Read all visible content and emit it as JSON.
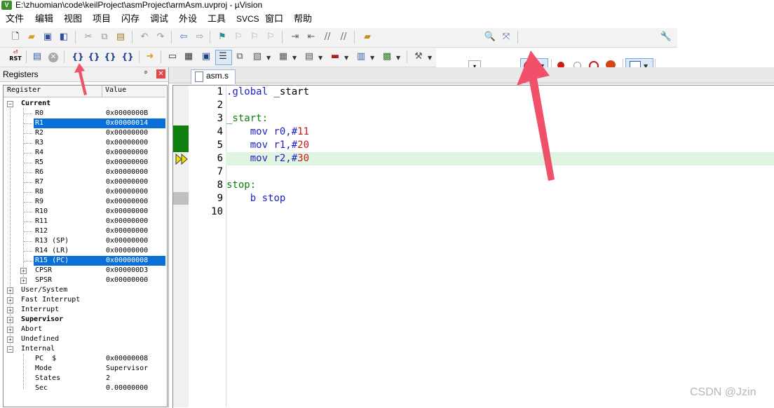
{
  "window": {
    "title": "E:\\zhuomian\\code\\keilProject\\asmProject\\armAsm.uvproj - µVision",
    "icon": "uvision-app-icon"
  },
  "menu": [
    "文件",
    "编辑",
    "视图",
    "项目",
    "闪存",
    "调试",
    "外设",
    "工具",
    "SVCS",
    "窗口",
    "帮助"
  ],
  "registers_panel": {
    "title": "Registers",
    "pin_icon": "pin-icon",
    "close_icon": "close-icon",
    "columns": {
      "register": "Register",
      "value": "Value"
    },
    "current_group": "Current",
    "rows": [
      {
        "name": "R0",
        "value": "0x0000000B"
      },
      {
        "name": "R1",
        "value": "0x00000014",
        "selected": true
      },
      {
        "name": "R2",
        "value": "0x00000000"
      },
      {
        "name": "R3",
        "value": "0x00000000"
      },
      {
        "name": "R4",
        "value": "0x00000000"
      },
      {
        "name": "R5",
        "value": "0x00000000"
      },
      {
        "name": "R6",
        "value": "0x00000000"
      },
      {
        "name": "R7",
        "value": "0x00000000"
      },
      {
        "name": "R8",
        "value": "0x00000000"
      },
      {
        "name": "R9",
        "value": "0x00000000"
      },
      {
        "name": "R10",
        "value": "0x00000000"
      },
      {
        "name": "R11",
        "value": "0x00000000"
      },
      {
        "name": "R12",
        "value": "0x00000000"
      },
      {
        "name": "R13 (SP)",
        "value": "0x00000000"
      },
      {
        "name": "R14 (LR)",
        "value": "0x00000000"
      },
      {
        "name": "R15 (PC)",
        "value": "0x00000008",
        "selected": true
      },
      {
        "name": "CPSR",
        "value": "0x000000D3",
        "expandable": true
      },
      {
        "name": "SPSR",
        "value": "0x00000000",
        "expandable": true
      }
    ],
    "groups": [
      "User/System",
      "Fast Interrupt",
      "Interrupt",
      "Supervisor",
      "Abort",
      "Undefined"
    ],
    "internal": {
      "label": "Internal",
      "rows": [
        {
          "name": "PC  $",
          "value": "0x00000008"
        },
        {
          "name": "Mode",
          "value": "Supervisor"
        },
        {
          "name": "States",
          "value": "2"
        },
        {
          "name": "Sec",
          "value": "0.00000000"
        }
      ]
    }
  },
  "editor": {
    "tab_label": "asm.s",
    "line_numbers": [
      "1",
      "2",
      "3",
      "4",
      "5",
      "6",
      "7",
      "8",
      "9",
      "10"
    ],
    "code": {
      "l1_a": ".global",
      "l1_b": " _start",
      "l3": "_start:",
      "l4_a": "    mov",
      "l4_b": " r0,#",
      "l4_c": "11",
      "l5_a": "    mov",
      "l5_b": " r1,#",
      "l5_c": "20",
      "l6_a": "    mov",
      "l6_b": " r2,#",
      "l6_c": "30",
      "l8": "stop:",
      "l9_a": "    b",
      "l9_b": " stop"
    },
    "current_line": 6
  },
  "colors": {
    "selection": "#0a6fd6",
    "code_keyword": "#1e1ec8",
    "code_label": "#0c7f0c",
    "code_number": "#d01818",
    "annotation_arrow": "#f0506a"
  },
  "watermark": "CSDN @Jzin"
}
